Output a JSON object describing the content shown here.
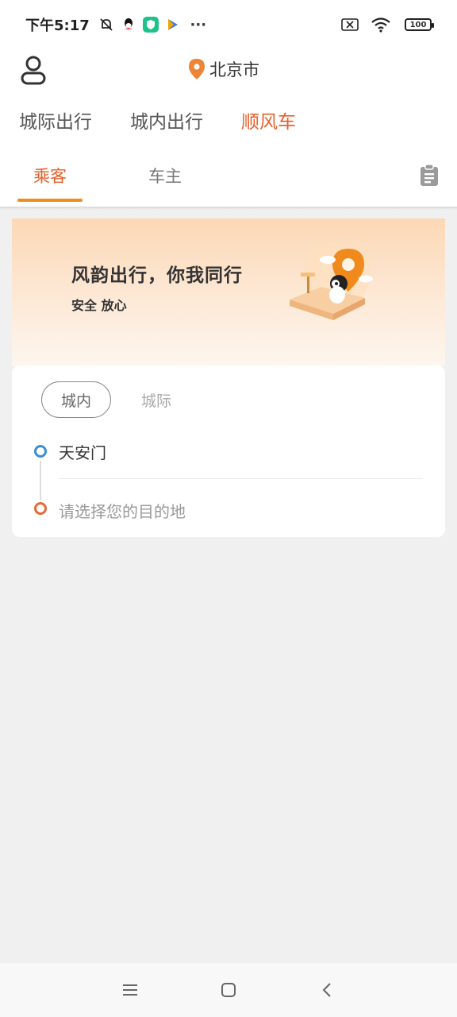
{
  "status_bar": {
    "time": "下午5:17",
    "more": "···",
    "battery": "100"
  },
  "header": {
    "city": "北京市",
    "mode_tabs": [
      {
        "label": "城际出行",
        "active": false
      },
      {
        "label": "城内出行",
        "active": false
      },
      {
        "label": "顺风车",
        "active": true
      }
    ],
    "role_tabs": [
      {
        "label": "乘客",
        "active": true
      },
      {
        "label": "车主",
        "active": false
      }
    ]
  },
  "banner": {
    "title": "风韵出行，你我同行",
    "subtitle": "安全 放心"
  },
  "card": {
    "scope_tabs": [
      {
        "label": "城内",
        "active": true
      },
      {
        "label": "城际",
        "active": false
      }
    ],
    "from": "天安门",
    "to_placeholder": "请选择您的目的地"
  },
  "colors": {
    "accent": "#e8602c",
    "indicator": "#ef8c1c",
    "from_dot": "#3a8fd6",
    "to_dot": "#e56a3b"
  }
}
